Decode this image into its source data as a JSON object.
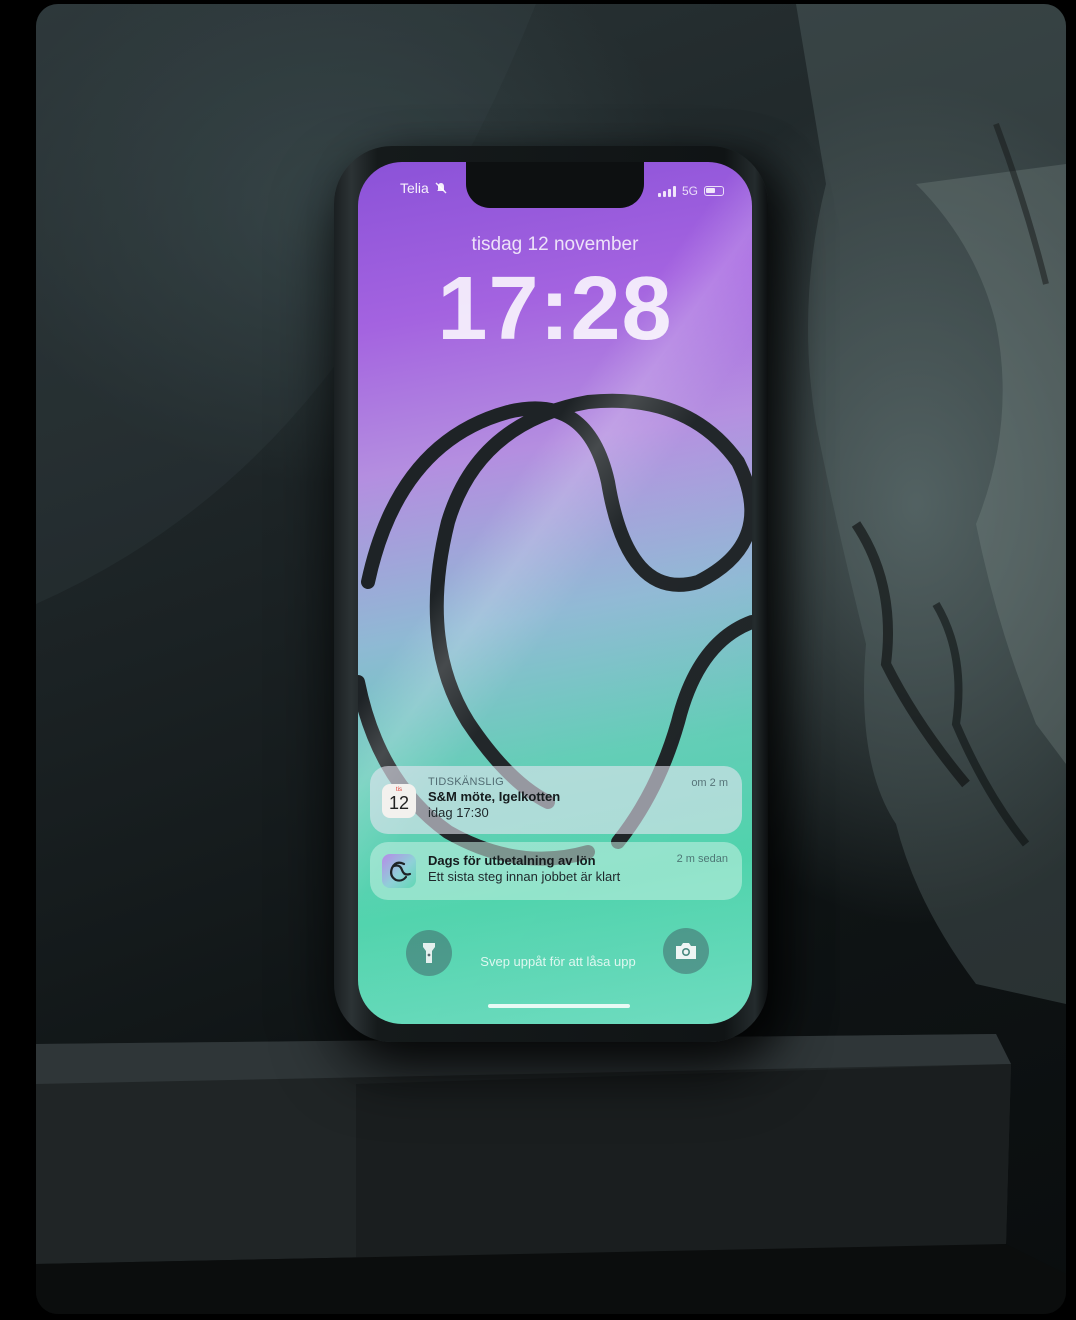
{
  "status_bar": {
    "carrier": "Telia",
    "network": "5G"
  },
  "lock_screen": {
    "date": "tisdag 12 november",
    "time": "17:28",
    "swipe_hint": "Svep uppåt för att låsa upp"
  },
  "notifications": [
    {
      "label": "TIDSKÄNSLIG",
      "title": "S&M möte, Igelkotten",
      "body": "idag 17:30",
      "time": "om 2 m",
      "icon": "calendar-icon",
      "icon_day": "tis",
      "icon_num": "12"
    },
    {
      "label": "",
      "title": "Dags för utbetalning av lön",
      "body": "Ett sista steg innan jobbet är klart",
      "time": "2 m sedan",
      "icon": "app-logo-icon"
    }
  ],
  "quick_actions": {
    "left_icon": "flashlight-icon",
    "right_icon": "camera-icon"
  },
  "colors": {
    "wallpaper_top": "#8b52d8",
    "wallpaper_mid": "#8fb9d4",
    "wallpaper_bottom": "#4fd3ac",
    "stroke": "#1e2326"
  }
}
